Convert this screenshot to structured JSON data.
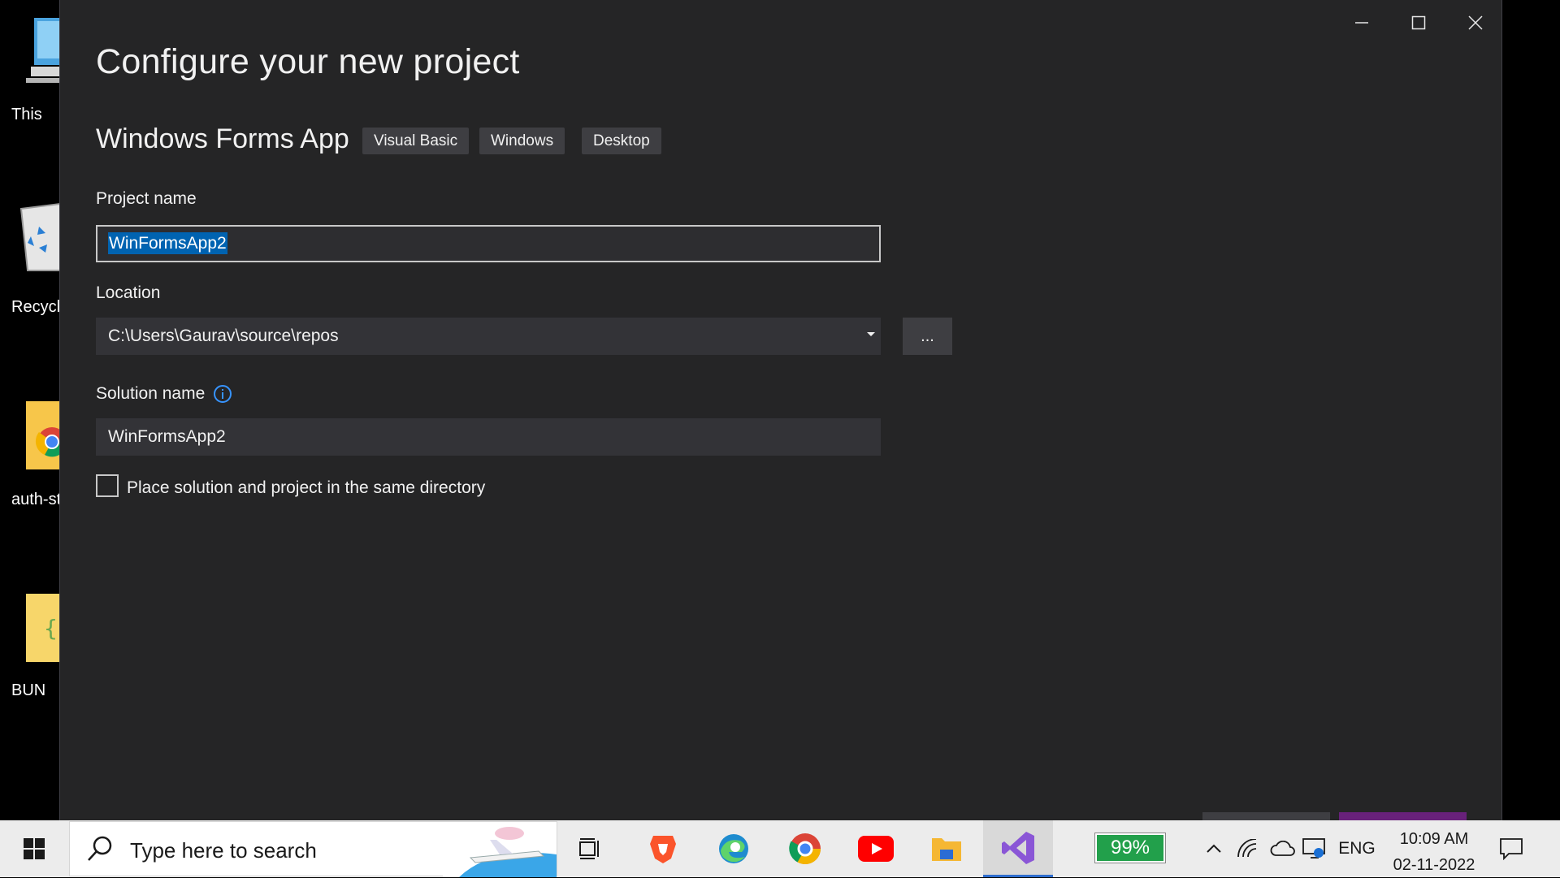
{
  "desktop": {
    "icons": [
      {
        "label": "This"
      },
      {
        "label": "Recycl"
      },
      {
        "label": "auth-st"
      },
      {
        "label": "BUN"
      }
    ]
  },
  "dialog": {
    "title": "Configure your new project",
    "template": {
      "name": "Windows Forms App",
      "tags": [
        "Visual Basic",
        "Windows",
        "Desktop"
      ]
    },
    "project_name": {
      "label": "Project name",
      "value": "WinFormsApp2"
    },
    "location": {
      "label": "Location",
      "value": "C:\\Users\\Gaurav\\source\\repos",
      "browse_label": "..."
    },
    "solution_name": {
      "label": "Solution name",
      "value": "WinFormsApp2"
    },
    "same_directory": {
      "label": "Place solution and project in the same directory",
      "checked": false
    }
  },
  "taskbar": {
    "search_placeholder": "Type here to search",
    "apps": [
      "task-view",
      "brave",
      "edge",
      "chrome",
      "youtube",
      "file-explorer",
      "visual-studio"
    ],
    "battery": "99%",
    "language": "ENG",
    "time": "10:09 AM",
    "date": "02-11-2022"
  },
  "colors": {
    "dialog_bg": "#252526",
    "input_bg": "#333337",
    "selection": "#0063b1",
    "accent_purple": "#68217a",
    "battery_green": "#22a04b"
  }
}
